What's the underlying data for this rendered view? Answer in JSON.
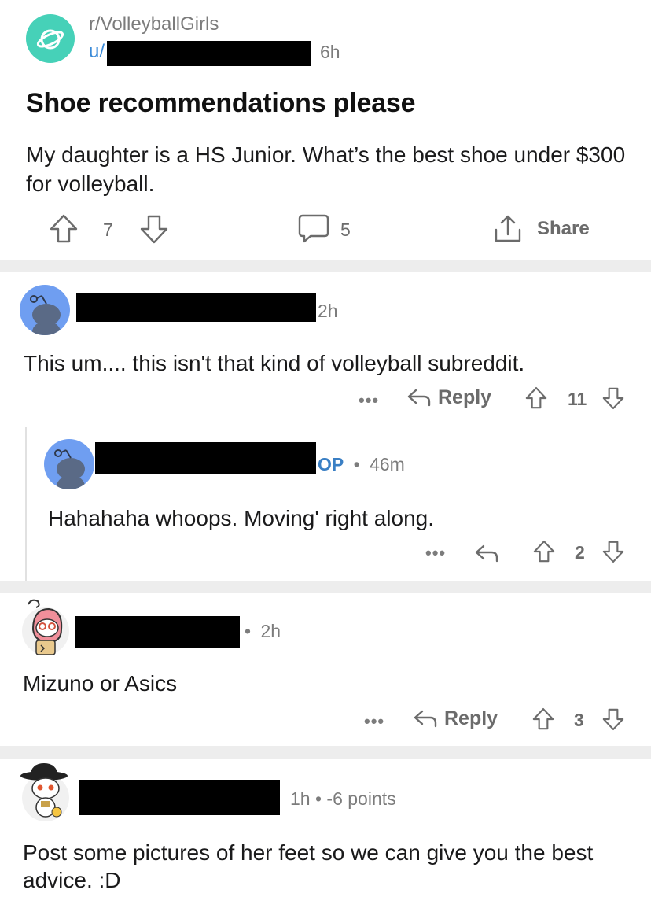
{
  "post": {
    "subreddit": "r/VolleyballGirls",
    "user_prefix": "u/",
    "age": "6h",
    "title": "Shoe recommendations please",
    "body": "My daughter is a HS Junior. What’s the best shoe under $300 for volleyball.",
    "votes": "7",
    "comments": "5",
    "share_label": "Share"
  },
  "comments": [
    {
      "age": "2h",
      "text": "This um.... this isn't that kind of volleyball subreddit.",
      "more": "•••",
      "reply_label": "Reply",
      "votes": "11"
    },
    {
      "op_badge": "OP",
      "separator": "•",
      "age": "46m",
      "text": "Hahahaha whoops. Moving' right along.",
      "more": "•••",
      "votes": "2"
    },
    {
      "separator": "•",
      "age": "2h",
      "text": "Mizuno or Asics",
      "more": "•••",
      "reply_label": "Reply",
      "votes": "3"
    },
    {
      "meta": "1h • -6 points",
      "text": "Post some pictures of her feet so we can give you the best advice. :D"
    }
  ],
  "colors": {
    "subreddit_icon": "#46d1b8",
    "link_blue": "#3a8ad8",
    "op_blue": "#3a7fc4",
    "default_avatar_bg": "#6f9ef1",
    "divider": "#ededed"
  },
  "icons": [
    "planet-icon",
    "upvote-icon",
    "downvote-icon",
    "comment-icon",
    "share-icon",
    "reply-icon",
    "more-icon",
    "snoo-avatar-icon"
  ]
}
